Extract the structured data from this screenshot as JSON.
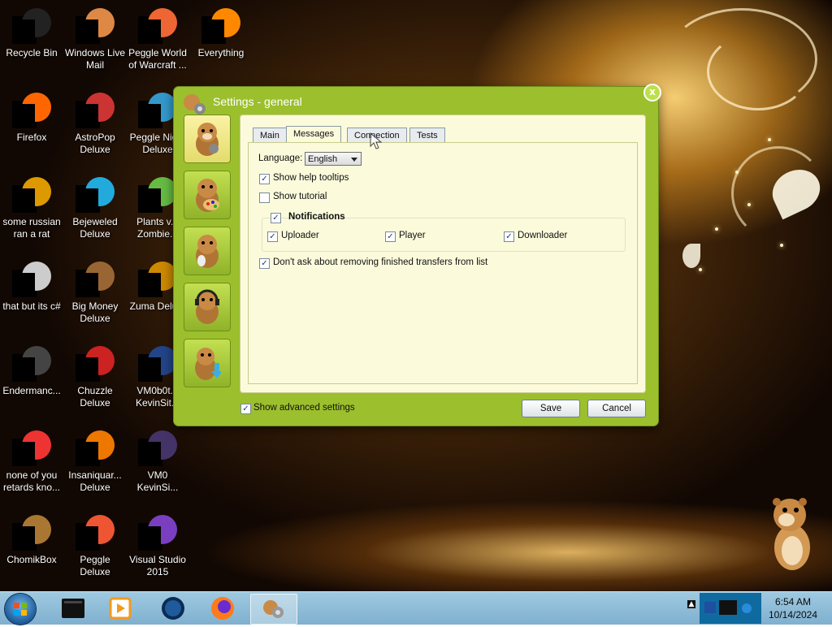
{
  "desktop": {
    "icons": [
      {
        "label": "Recycle Bin",
        "icon": "recycle-bin-icon"
      },
      {
        "label": "Windows Live Mail",
        "icon": "mail-icon"
      },
      {
        "label": "Peggle World of Warcraft ...",
        "icon": "peggle-icon"
      },
      {
        "label": "Everything",
        "icon": "search-icon"
      },
      {
        "label": "Firefox",
        "icon": "firefox-icon"
      },
      {
        "label": "AstroPop Deluxe",
        "icon": "astropop-icon"
      },
      {
        "label": "Peggle Nig... Deluxe",
        "icon": "peggle-icon"
      },
      {
        "label": "some russian ran a rat",
        "icon": "file-icon"
      },
      {
        "label": "Bejeweled Deluxe",
        "icon": "bejeweled-icon"
      },
      {
        "label": "Plants v... Zombie...",
        "icon": "plants-icon"
      },
      {
        "label": "that but its c#",
        "icon": "shortcut-icon"
      },
      {
        "label": "Big Money Deluxe",
        "icon": "money-icon"
      },
      {
        "label": "Zuma Delu...",
        "icon": "zuma-icon"
      },
      {
        "label": "Endermanc...",
        "icon": "app-icon"
      },
      {
        "label": "Chuzzle Deluxe",
        "icon": "chuzzle-icon"
      },
      {
        "label": "VM0b0t... KevinSit...",
        "icon": "vm-icon"
      },
      {
        "label": "none of you retards kno...",
        "icon": "chrome-icon"
      },
      {
        "label": "Insaniquar... Deluxe",
        "icon": "fish-icon"
      },
      {
        "label": "VM0 KevinSi...",
        "icon": "vm-icon"
      },
      {
        "label": "ChomikBox",
        "icon": "hamster-icon"
      },
      {
        "label": "Peggle Deluxe",
        "icon": "peggle-icon"
      },
      {
        "label": "Visual Studio 2015",
        "icon": "visual-studio-icon"
      }
    ]
  },
  "dialog": {
    "title": "Settings - general",
    "close_label": "x",
    "tabs": [
      "Main",
      "Messages",
      "Connection",
      "Tests"
    ],
    "selected_tab": "Messages",
    "language_label": "Language:",
    "language_value": "English",
    "show_help_tooltips": {
      "label": "Show help tooltips",
      "checked": true
    },
    "show_tutorial": {
      "label": "Show tutorial",
      "checked": false
    },
    "notifications": {
      "label": "Notifications",
      "checked": true,
      "items": [
        {
          "label": "Uploader",
          "checked": true
        },
        {
          "label": "Player",
          "checked": true
        },
        {
          "label": "Downloader",
          "checked": true
        }
      ]
    },
    "dont_ask_removing": {
      "label": "Don't ask about removing finished transfers from list",
      "checked": true
    },
    "show_advanced": {
      "label": "Show advanced settings",
      "checked": true
    },
    "save_label": "Save",
    "cancel_label": "Cancel",
    "check_mark": "✓"
  },
  "taskbar": {
    "items": [
      "terminal-icon",
      "media-player-icon",
      "globe-icon",
      "firefox-icon",
      "settings-app-icon"
    ],
    "active_item": "settings-app-icon",
    "clock_time": "6:54 AM",
    "clock_date": "10/14/2024"
  }
}
